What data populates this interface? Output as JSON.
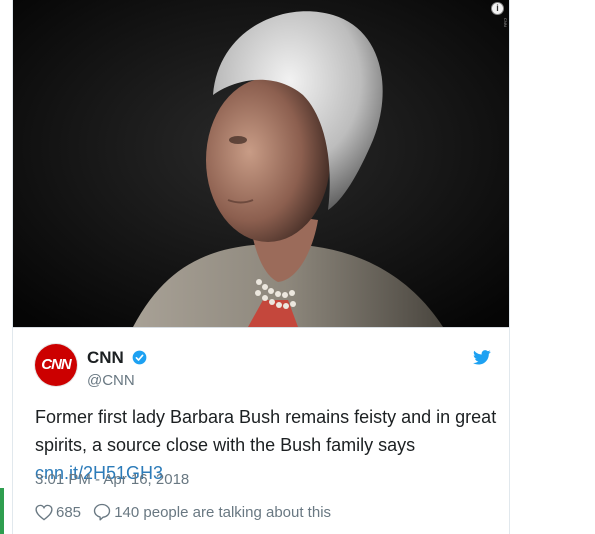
{
  "tweet": {
    "author": {
      "name": "CNN",
      "handle": "@CNN",
      "avatar_text": "CNN"
    },
    "text": "Former first lady Barbara Bush remains feisty and in great spirits, a source close with the Bush family says ",
    "link_text": "cnn.it/2H51GH3",
    "timestamp": "3:01 PM - Apr 16, 2018",
    "likes": "685",
    "discussion": "140 people are talking about this"
  },
  "media": {
    "info_glyph": "i",
    "credit": "CNN"
  },
  "colors": {
    "brand_red": "#cc0000",
    "link_blue": "#2b7bb9",
    "twitter_blue": "#1da1f2",
    "text_gray": "#697882"
  }
}
